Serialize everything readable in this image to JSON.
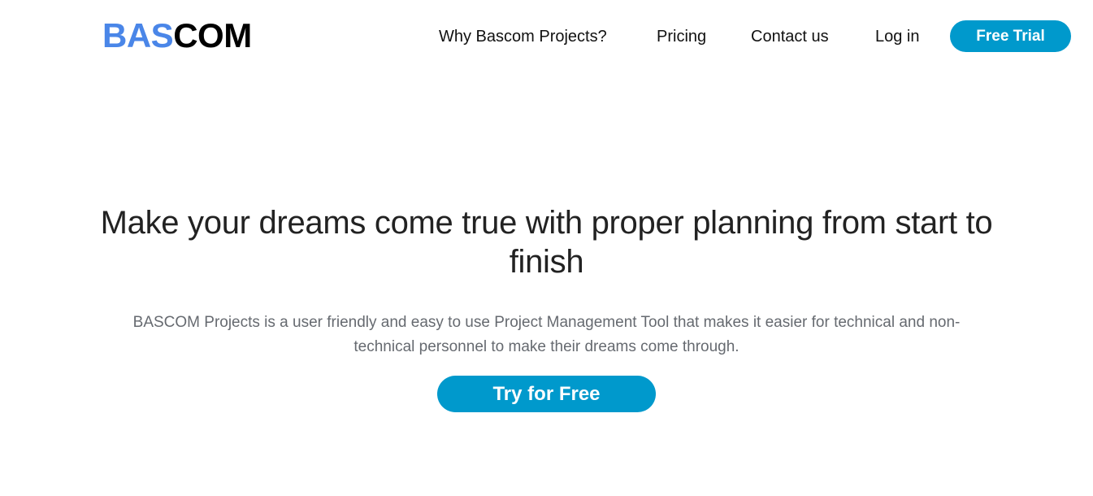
{
  "header": {
    "logo": {
      "part1": "BAS",
      "part2": "COM",
      "accent_color": "#4a86e8",
      "dark_color": "#000000"
    },
    "nav": {
      "why_label": "Why Bascom Projects?",
      "pricing_label": "Pricing",
      "contact_label": "Contact us",
      "login_label": "Log in"
    },
    "free_trial_label": "Free Trial",
    "button_color": "#0099cc"
  },
  "hero": {
    "title": "Make your dreams come true with proper planning from start to finish",
    "subtitle": "BASCOM Projects is a user friendly and easy to use Project Management Tool that makes it easier for technical and non-technical personnel to make their dreams come through.",
    "cta_label": "Try for Free"
  }
}
